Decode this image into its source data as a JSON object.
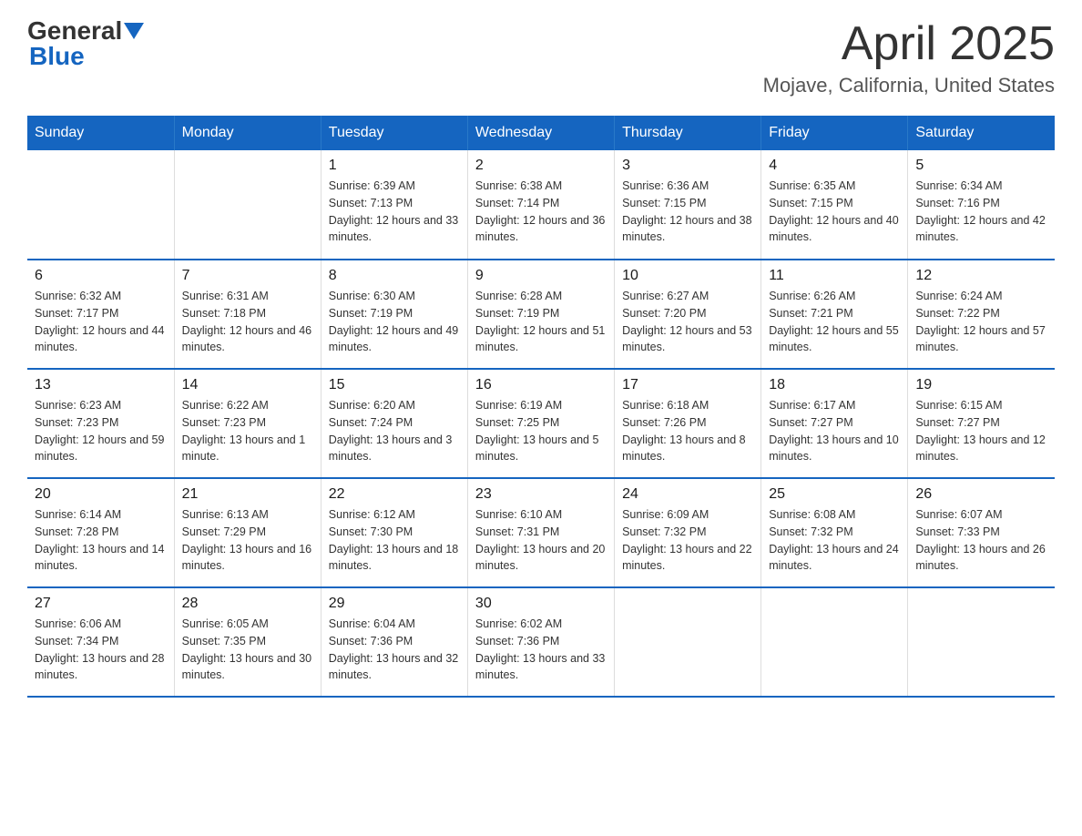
{
  "header": {
    "logo_text_general": "General",
    "logo_text_blue": "Blue",
    "month_title": "April 2025",
    "location": "Mojave, California, United States"
  },
  "days_of_week": [
    "Sunday",
    "Monday",
    "Tuesday",
    "Wednesday",
    "Thursday",
    "Friday",
    "Saturday"
  ],
  "weeks": [
    [
      {
        "day": "",
        "sunrise": "",
        "sunset": "",
        "daylight": ""
      },
      {
        "day": "",
        "sunrise": "",
        "sunset": "",
        "daylight": ""
      },
      {
        "day": "1",
        "sunrise": "Sunrise: 6:39 AM",
        "sunset": "Sunset: 7:13 PM",
        "daylight": "Daylight: 12 hours and 33 minutes."
      },
      {
        "day": "2",
        "sunrise": "Sunrise: 6:38 AM",
        "sunset": "Sunset: 7:14 PM",
        "daylight": "Daylight: 12 hours and 36 minutes."
      },
      {
        "day": "3",
        "sunrise": "Sunrise: 6:36 AM",
        "sunset": "Sunset: 7:15 PM",
        "daylight": "Daylight: 12 hours and 38 minutes."
      },
      {
        "day": "4",
        "sunrise": "Sunrise: 6:35 AM",
        "sunset": "Sunset: 7:15 PM",
        "daylight": "Daylight: 12 hours and 40 minutes."
      },
      {
        "day": "5",
        "sunrise": "Sunrise: 6:34 AM",
        "sunset": "Sunset: 7:16 PM",
        "daylight": "Daylight: 12 hours and 42 minutes."
      }
    ],
    [
      {
        "day": "6",
        "sunrise": "Sunrise: 6:32 AM",
        "sunset": "Sunset: 7:17 PM",
        "daylight": "Daylight: 12 hours and 44 minutes."
      },
      {
        "day": "7",
        "sunrise": "Sunrise: 6:31 AM",
        "sunset": "Sunset: 7:18 PM",
        "daylight": "Daylight: 12 hours and 46 minutes."
      },
      {
        "day": "8",
        "sunrise": "Sunrise: 6:30 AM",
        "sunset": "Sunset: 7:19 PM",
        "daylight": "Daylight: 12 hours and 49 minutes."
      },
      {
        "day": "9",
        "sunrise": "Sunrise: 6:28 AM",
        "sunset": "Sunset: 7:19 PM",
        "daylight": "Daylight: 12 hours and 51 minutes."
      },
      {
        "day": "10",
        "sunrise": "Sunrise: 6:27 AM",
        "sunset": "Sunset: 7:20 PM",
        "daylight": "Daylight: 12 hours and 53 minutes."
      },
      {
        "day": "11",
        "sunrise": "Sunrise: 6:26 AM",
        "sunset": "Sunset: 7:21 PM",
        "daylight": "Daylight: 12 hours and 55 minutes."
      },
      {
        "day": "12",
        "sunrise": "Sunrise: 6:24 AM",
        "sunset": "Sunset: 7:22 PM",
        "daylight": "Daylight: 12 hours and 57 minutes."
      }
    ],
    [
      {
        "day": "13",
        "sunrise": "Sunrise: 6:23 AM",
        "sunset": "Sunset: 7:23 PM",
        "daylight": "Daylight: 12 hours and 59 minutes."
      },
      {
        "day": "14",
        "sunrise": "Sunrise: 6:22 AM",
        "sunset": "Sunset: 7:23 PM",
        "daylight": "Daylight: 13 hours and 1 minute."
      },
      {
        "day": "15",
        "sunrise": "Sunrise: 6:20 AM",
        "sunset": "Sunset: 7:24 PM",
        "daylight": "Daylight: 13 hours and 3 minutes."
      },
      {
        "day": "16",
        "sunrise": "Sunrise: 6:19 AM",
        "sunset": "Sunset: 7:25 PM",
        "daylight": "Daylight: 13 hours and 5 minutes."
      },
      {
        "day": "17",
        "sunrise": "Sunrise: 6:18 AM",
        "sunset": "Sunset: 7:26 PM",
        "daylight": "Daylight: 13 hours and 8 minutes."
      },
      {
        "day": "18",
        "sunrise": "Sunrise: 6:17 AM",
        "sunset": "Sunset: 7:27 PM",
        "daylight": "Daylight: 13 hours and 10 minutes."
      },
      {
        "day": "19",
        "sunrise": "Sunrise: 6:15 AM",
        "sunset": "Sunset: 7:27 PM",
        "daylight": "Daylight: 13 hours and 12 minutes."
      }
    ],
    [
      {
        "day": "20",
        "sunrise": "Sunrise: 6:14 AM",
        "sunset": "Sunset: 7:28 PM",
        "daylight": "Daylight: 13 hours and 14 minutes."
      },
      {
        "day": "21",
        "sunrise": "Sunrise: 6:13 AM",
        "sunset": "Sunset: 7:29 PM",
        "daylight": "Daylight: 13 hours and 16 minutes."
      },
      {
        "day": "22",
        "sunrise": "Sunrise: 6:12 AM",
        "sunset": "Sunset: 7:30 PM",
        "daylight": "Daylight: 13 hours and 18 minutes."
      },
      {
        "day": "23",
        "sunrise": "Sunrise: 6:10 AM",
        "sunset": "Sunset: 7:31 PM",
        "daylight": "Daylight: 13 hours and 20 minutes."
      },
      {
        "day": "24",
        "sunrise": "Sunrise: 6:09 AM",
        "sunset": "Sunset: 7:32 PM",
        "daylight": "Daylight: 13 hours and 22 minutes."
      },
      {
        "day": "25",
        "sunrise": "Sunrise: 6:08 AM",
        "sunset": "Sunset: 7:32 PM",
        "daylight": "Daylight: 13 hours and 24 minutes."
      },
      {
        "day": "26",
        "sunrise": "Sunrise: 6:07 AM",
        "sunset": "Sunset: 7:33 PM",
        "daylight": "Daylight: 13 hours and 26 minutes."
      }
    ],
    [
      {
        "day": "27",
        "sunrise": "Sunrise: 6:06 AM",
        "sunset": "Sunset: 7:34 PM",
        "daylight": "Daylight: 13 hours and 28 minutes."
      },
      {
        "day": "28",
        "sunrise": "Sunrise: 6:05 AM",
        "sunset": "Sunset: 7:35 PM",
        "daylight": "Daylight: 13 hours and 30 minutes."
      },
      {
        "day": "29",
        "sunrise": "Sunrise: 6:04 AM",
        "sunset": "Sunset: 7:36 PM",
        "daylight": "Daylight: 13 hours and 32 minutes."
      },
      {
        "day": "30",
        "sunrise": "Sunrise: 6:02 AM",
        "sunset": "Sunset: 7:36 PM",
        "daylight": "Daylight: 13 hours and 33 minutes."
      },
      {
        "day": "",
        "sunrise": "",
        "sunset": "",
        "daylight": ""
      },
      {
        "day": "",
        "sunrise": "",
        "sunset": "",
        "daylight": ""
      },
      {
        "day": "",
        "sunrise": "",
        "sunset": "",
        "daylight": ""
      }
    ]
  ]
}
